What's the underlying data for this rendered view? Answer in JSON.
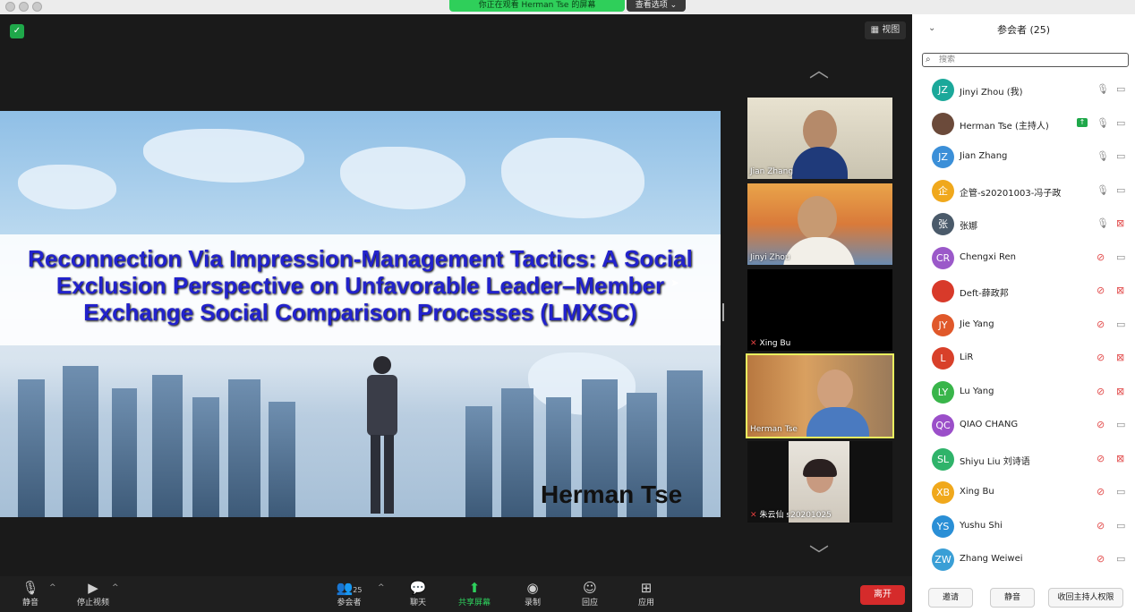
{
  "share_bar": {
    "status": "你正在观看 Herman Tse 的屏幕",
    "options": "查看选项 ⌄"
  },
  "stage": {
    "view_label": "视图"
  },
  "slide": {
    "title": "Reconnection Via Impression-Management Tactics: A Social Exclusion Perspective on Unfavorable Leader–Member Exchange Social Comparison Processes (LMXSC)",
    "presenter": "Herman Tse"
  },
  "thumbnails": [
    {
      "name": "Jian Zhang",
      "muted": false
    },
    {
      "name": "Jinyi Zhou",
      "muted": false
    },
    {
      "name": "Xing Bu",
      "muted": true
    },
    {
      "name": "Herman Tse",
      "muted": false,
      "active": true
    },
    {
      "name": "朱云仙 s20201025",
      "muted": true
    }
  ],
  "toolbar": {
    "mute": "静音",
    "stop_video": "停止视频",
    "participants": "参会者",
    "participants_count": "25",
    "chat": "聊天",
    "share": "共享屏幕",
    "record": "录制",
    "reactions": "回应",
    "apps": "应用",
    "leave": "离开"
  },
  "panel": {
    "title": "参会者 (25)",
    "search_placeholder": "搜索",
    "participants": [
      {
        "initials": "JZ",
        "name": "Jinyi Zhou (我)",
        "color": "#1ba89a",
        "mic": "on",
        "video": "on"
      },
      {
        "initials": "",
        "name": "Herman Tse (主持人)",
        "color": "#6b4a3a",
        "mic": "on",
        "video": "on",
        "sharing": true
      },
      {
        "initials": "JZ",
        "name": "Jian Zhang",
        "color": "#3b8fd8",
        "mic": "on",
        "video": "on"
      },
      {
        "initials": "企",
        "name": "企管-s20201003-冯子政",
        "color": "#f0a81c",
        "mic": "on",
        "video": "on"
      },
      {
        "initials": "张",
        "name": "张娜",
        "color": "#4a5a6a",
        "mic": "on",
        "video": "off"
      },
      {
        "initials": "CR",
        "name": "Chengxi Ren",
        "color": "#9b59c9",
        "mic": "off",
        "video": "on"
      },
      {
        "initials": "",
        "name": "Deft-薛政邦",
        "color": "#d83a2a",
        "mic": "off",
        "video": "off"
      },
      {
        "initials": "JY",
        "name": "Jie Yang",
        "color": "#e0582a",
        "mic": "off",
        "video": "on"
      },
      {
        "initials": "L",
        "name": "LiR",
        "color": "#d8402a",
        "mic": "off",
        "video": "off"
      },
      {
        "initials": "LY",
        "name": "Lu Yang",
        "color": "#39b54a",
        "mic": "off",
        "video": "off"
      },
      {
        "initials": "QC",
        "name": "QIAO CHANG",
        "color": "#9b4fc9",
        "mic": "off",
        "video": "on"
      },
      {
        "initials": "SL",
        "name": "Shiyu Liu  刘诗语",
        "color": "#2fb36a",
        "mic": "off",
        "video": "off"
      },
      {
        "initials": "XB",
        "name": "Xing Bu",
        "color": "#f0a81c",
        "mic": "off",
        "video": "on"
      },
      {
        "initials": "YS",
        "name": "Yushu Shi",
        "color": "#2a8fd6",
        "mic": "off",
        "video": "on"
      },
      {
        "initials": "ZW",
        "name": "Zhang Weiwei",
        "color": "#3a9fd6",
        "mic": "off",
        "video": "on"
      }
    ],
    "footer": {
      "invite": "邀请",
      "mute_all": "静音",
      "reclaim": "收回主持人权限"
    }
  }
}
